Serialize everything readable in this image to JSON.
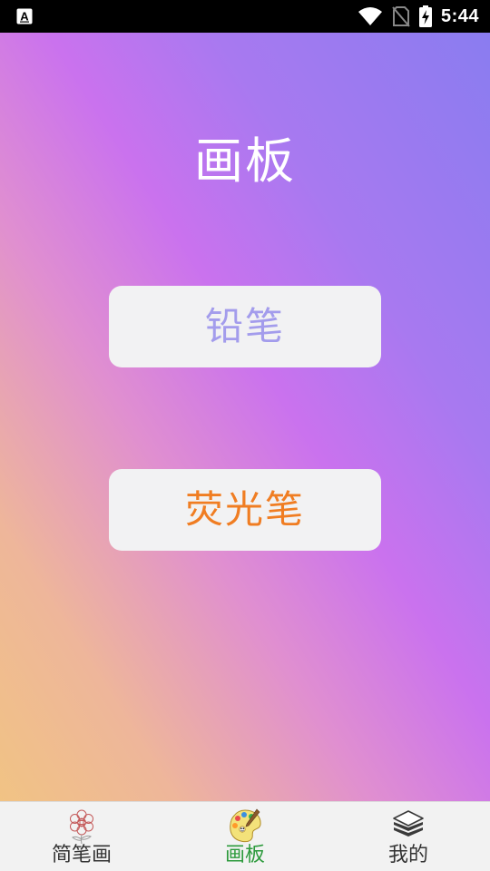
{
  "status_bar": {
    "time": "5:44",
    "left_icon": "a-notification-icon",
    "icons": [
      "wifi-icon",
      "no-sim-icon",
      "battery-charging-icon"
    ]
  },
  "page": {
    "title": "画板"
  },
  "tools": {
    "pencil_label": "铅笔",
    "highlighter_label": "荧光笔"
  },
  "bottom_nav": {
    "items": [
      {
        "label": "简笔画",
        "icon": "flower-sketch-icon",
        "active": false
      },
      {
        "label": "画板",
        "icon": "palette-icon",
        "active": true
      },
      {
        "label": "我的",
        "icon": "layers-icon",
        "active": false
      }
    ]
  },
  "colors": {
    "pencil_text": "#a39cec",
    "highlighter_text": "#f07d22",
    "nav_active": "#2c9a3c",
    "nav_inactive": "#333333",
    "button_bg": "#f2f2f3",
    "status_bar_bg": "#000000"
  }
}
